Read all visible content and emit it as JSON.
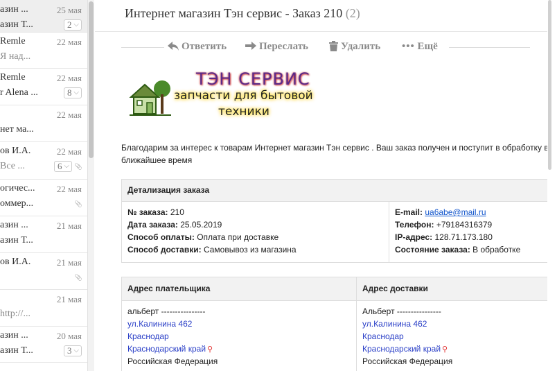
{
  "message_list": [
    {
      "line1": "азин ...",
      "line2": "азин Т...",
      "date": "25 мая",
      "count": "2",
      "selected": true
    },
    {
      "line1": "Remle",
      "line2": "Я над...",
      "date": "22 мая",
      "muted2": true
    },
    {
      "line1": "Remle",
      "line2": "r Alena ...",
      "date": "22 мая",
      "count": "8"
    },
    {
      "line1": "",
      "line2": "нет ма...",
      "date": "22 мая"
    },
    {
      "line1": "ов И.А.",
      "line2": "Все ...",
      "date": "22 мая",
      "count": "6",
      "clip": true,
      "muted2": true
    },
    {
      "line1": "огичес...",
      "line2": "оммер...",
      "date": "22 мая",
      "clip": true
    },
    {
      "line1": "азин ...",
      "line2": "азин Т...",
      "date": "21 мая"
    },
    {
      "line1": "ов И.А.",
      "line2": "",
      "date": "21 мая",
      "clip": true
    },
    {
      "line1": "",
      "line2": "http://...",
      "date": "21 мая",
      "muted2": true
    },
    {
      "line1": "азин ...",
      "line2": "азин Т...",
      "date": "20 мая",
      "count": "3"
    },
    {
      "line1": "",
      "line2": "",
      "date": ""
    }
  ],
  "subject": {
    "title": "Интернет магазин Тэн сервис - Заказ 210",
    "count": "(2)"
  },
  "toolbar": {
    "reply": "Ответить",
    "forward": "Переслать",
    "delete": "Удалить",
    "more": "Ещё"
  },
  "logo": {
    "line1": "ТЭН  СЕРВИС",
    "line2": "запчасти для бытовой",
    "line3": "техники"
  },
  "intro": "Благодарим за интерес к товарам Интернет магазин Тэн сервис . Ваш заказ получен и поступит в обработку в ближайшее время",
  "details": {
    "header": "Детализация заказа",
    "left": [
      {
        "label": "№ заказа:",
        "value": "210"
      },
      {
        "label": "Дата заказа:",
        "value": "25.05.2019"
      },
      {
        "label": "Способ оплаты:",
        "value": "Оплата при доставке"
      },
      {
        "label": "Способ доставки:",
        "value": "Самовывоз из магазина"
      }
    ],
    "right": [
      {
        "label": "E-mail:",
        "value": "ua6abe@mail.ru"
      },
      {
        "label": "Телефон:",
        "value": "+79184316379"
      },
      {
        "label": "IP-адрес:",
        "value": "128.71.173.180"
      },
      {
        "label": "Состояние заказа:",
        "value": "В обработке"
      }
    ]
  },
  "addresses": {
    "payer_header": "Адрес плательщика",
    "delivery_header": "Адрес доставки",
    "payer": {
      "name": "альберт ----------------",
      "street": "ул.Калинина 462",
      "city": "Краснодар",
      "region": "Краснодарский край",
      "country": "Российская Федерация"
    },
    "delivery": {
      "name": "Альберт ----------------",
      "street": "ул.Калинина 462",
      "city": "Краснодар",
      "region": "Краснодарский край",
      "country": "Российская Федерация"
    }
  },
  "colors": {
    "accent_link": "#2a3fc7",
    "pin": "#e03030",
    "logo_title": "#5a2a8a"
  }
}
